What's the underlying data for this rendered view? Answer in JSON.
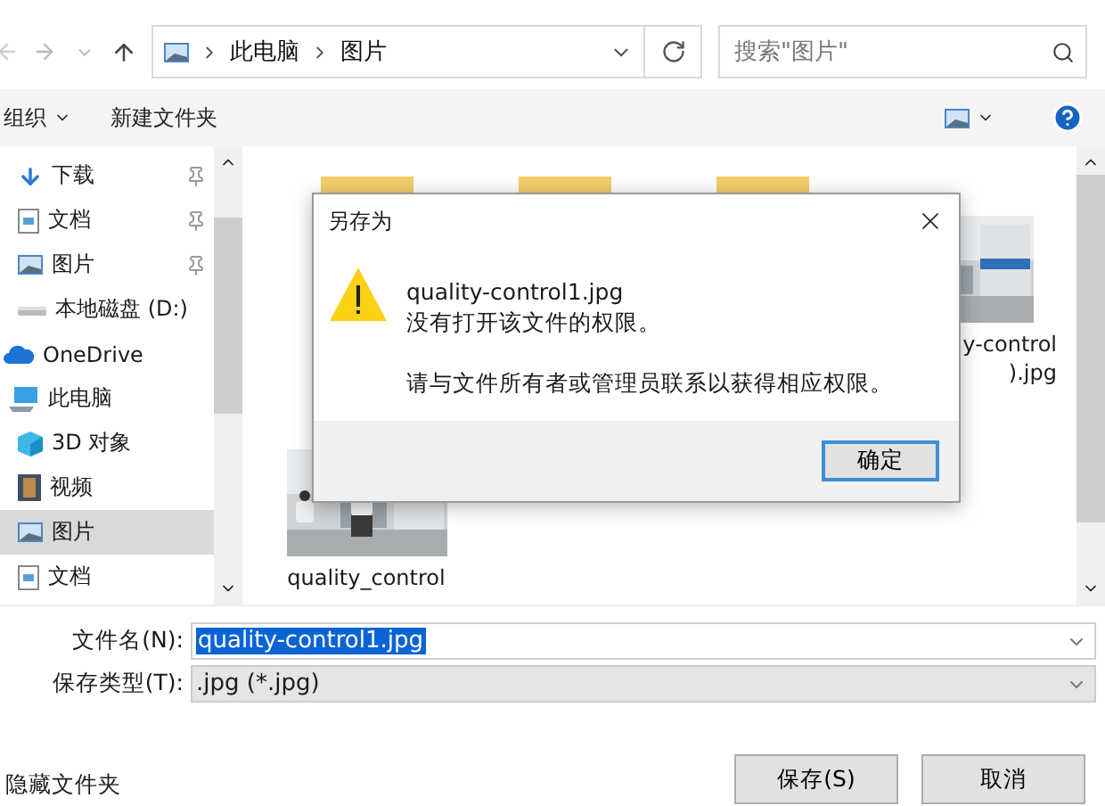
{
  "address": {
    "path": [
      "此电脑",
      "图片"
    ]
  },
  "search": {
    "placeholder": "搜索\"图片\""
  },
  "toolbar": {
    "organize": "组织",
    "new_folder": "新建文件夹"
  },
  "sidebar": {
    "items": [
      {
        "kind": "download",
        "label": "下载",
        "pinned": true,
        "selected": false
      },
      {
        "kind": "document",
        "label": "文档",
        "pinned": true,
        "selected": false
      },
      {
        "kind": "pictures",
        "label": "图片",
        "pinned": true,
        "selected": false
      },
      {
        "kind": "drive",
        "label": "本地磁盘 (D:)",
        "pinned": false,
        "selected": false
      },
      {
        "kind": "cloud",
        "label": "OneDrive",
        "pinned": false,
        "selected": false
      },
      {
        "kind": "computer",
        "label": "此电脑",
        "pinned": false,
        "selected": false,
        "children": [
          {
            "kind": "cube",
            "label": "3D 对象",
            "pinned": false,
            "selected": false
          },
          {
            "kind": "video",
            "label": "视频",
            "pinned": false,
            "selected": false
          },
          {
            "kind": "pictures",
            "label": "图片",
            "pinned": false,
            "selected": true
          },
          {
            "kind": "document",
            "label": "文档",
            "pinned": false,
            "selected": false
          }
        ]
      }
    ]
  },
  "files": [
    {
      "kind": "folder"
    },
    {
      "kind": "folder"
    },
    {
      "kind": "folder"
    },
    {
      "kind": "picture",
      "label": [
        "y-control",
        ").jpg"
      ]
    },
    {
      "kind": "picture",
      "label": [
        "quality_control"
      ]
    }
  ],
  "dialog": {
    "title": "另存为",
    "file": "quality-control1.jpg",
    "message": "没有打开该文件的权限。",
    "hint": "请与文件所有者或管理员联系以获得相应权限。",
    "ok": "确定"
  },
  "form": {
    "filename_label": "文件名(N):",
    "filename": "quality-control1.jpg",
    "type_label": "保存类型(T):",
    "type": ".jpg (*.jpg)"
  },
  "footer": {
    "hide_folders": "隐藏文件夹",
    "save": "保存(S)",
    "cancel": "取消"
  }
}
